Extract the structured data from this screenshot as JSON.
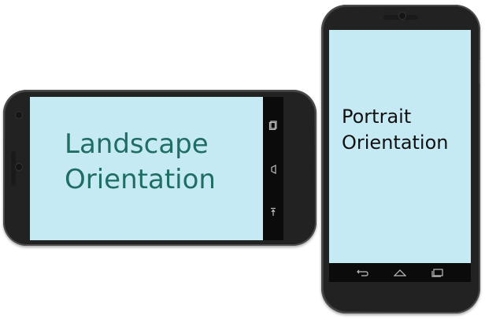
{
  "landscape_phone": {
    "caption_line1": "Landscape",
    "caption_line2": "Orientation",
    "nav_icons": [
      "recents-icon",
      "home-icon",
      "back-icon"
    ],
    "screen_color": "#c6eaf3",
    "text_color": "#1f6d63"
  },
  "portrait_phone": {
    "caption_line1": "Portrait",
    "caption_line2": "Orientation",
    "nav_icons": [
      "back-icon",
      "home-icon",
      "recents-icon"
    ],
    "screen_color": "#c6eaf3",
    "text_color": "#111111"
  }
}
